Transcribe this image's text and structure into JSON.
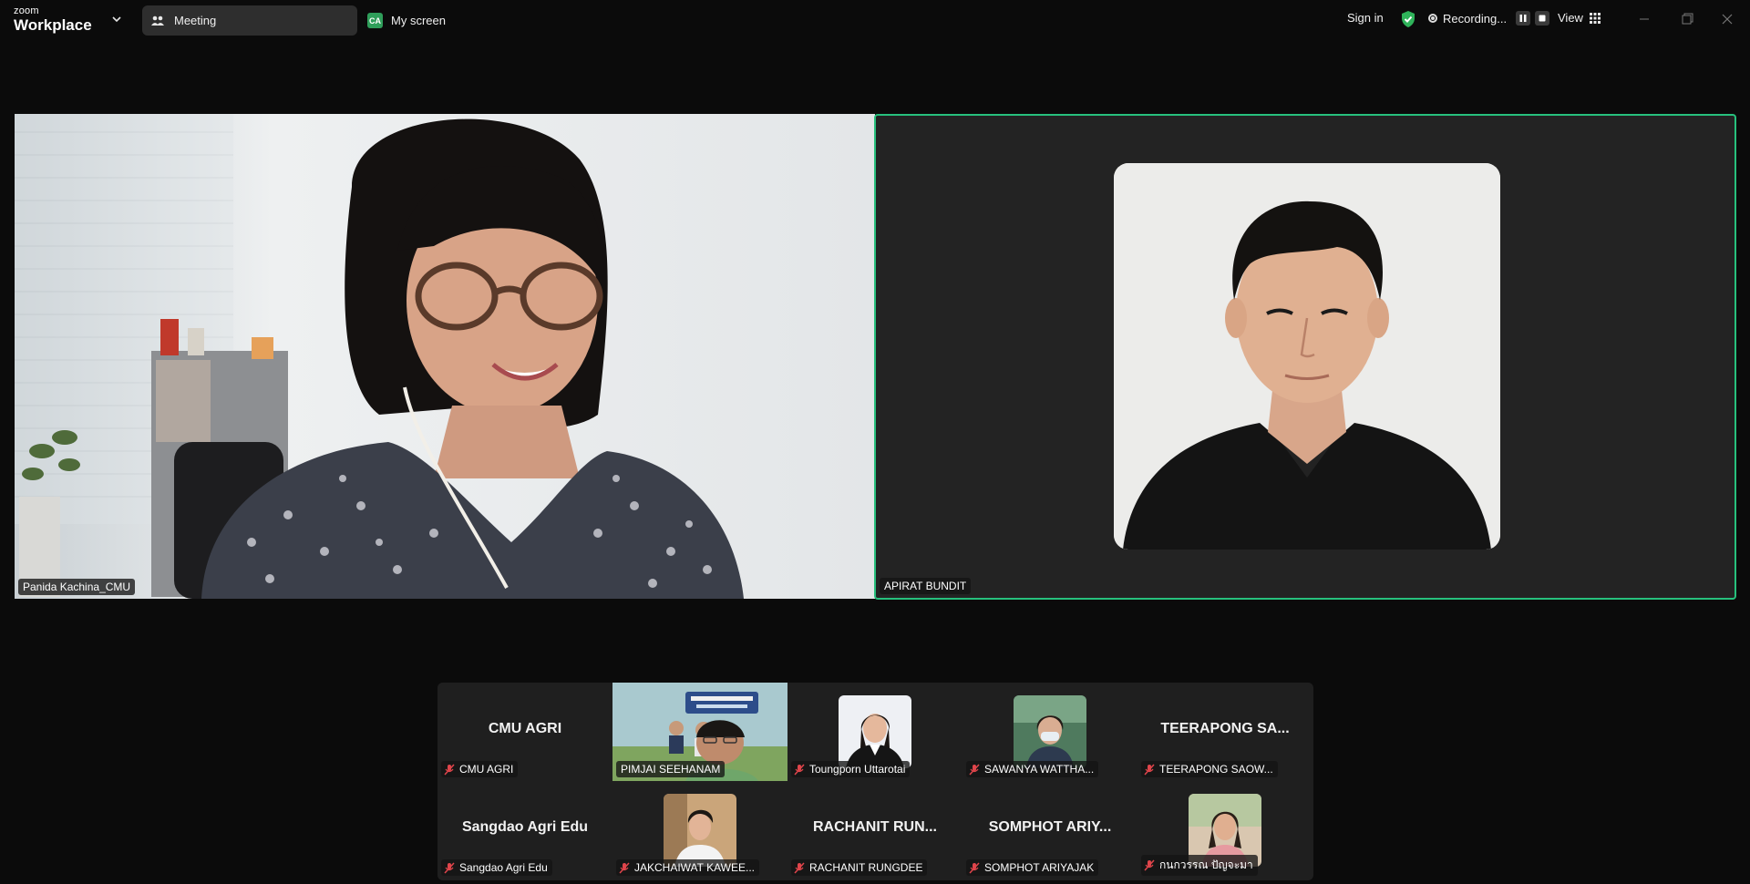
{
  "app": {
    "logo_small": "zoom",
    "logo_big": "Workplace"
  },
  "tabs": {
    "meeting": "Meeting",
    "my_screen": "My screen",
    "my_screen_badge": "CA"
  },
  "header": {
    "sign_in": "Sign in",
    "recording": "Recording...",
    "view": "View"
  },
  "main_videos": [
    {
      "name": "Panida Kachina_CMU",
      "active_speaker": false
    },
    {
      "name": "APIRAT BUNDIT",
      "active_speaker": true
    }
  ],
  "gallery": [
    {
      "display": "CMU AGRI",
      "name": "CMU AGRI",
      "muted": true,
      "kind": "text"
    },
    {
      "display": "",
      "name": "PIMJAI SEEHANAM",
      "muted": false,
      "kind": "video"
    },
    {
      "display": "",
      "name": "Toungporn Uttarotai",
      "muted": true,
      "kind": "photo"
    },
    {
      "display": "",
      "name": "SAWANYA WATTHA...",
      "muted": true,
      "kind": "photo"
    },
    {
      "display": "TEERAPONG SA...",
      "name": "TEERAPONG SAOW...",
      "muted": true,
      "kind": "text"
    },
    {
      "display": "Sangdao Agri Edu",
      "name": "Sangdao Agri Edu",
      "muted": true,
      "kind": "text"
    },
    {
      "display": "",
      "name": "JAKCHAIWAT KAWEE...",
      "muted": true,
      "kind": "photo"
    },
    {
      "display": "RACHANIT RUN...",
      "name": "RACHANIT RUNGDEE",
      "muted": true,
      "kind": "text"
    },
    {
      "display": "SOMPHOT ARIY...",
      "name": "SOMPHOT ARIYAJAK",
      "muted": true,
      "kind": "text"
    },
    {
      "display": "",
      "name": "กนกวรรณ ปัญจะมา",
      "muted": true,
      "kind": "photo"
    }
  ],
  "colors": {
    "active_border": "#27c07d",
    "muted_icon": "#e0454b",
    "shield": "#2fb35a"
  },
  "icons": [
    "chevron-down-icon",
    "meeting-icon",
    "shield-check-icon",
    "record-icon",
    "pause-icon",
    "stop-icon",
    "grid-view-icon",
    "minimize-icon",
    "maximize-icon",
    "close-icon",
    "mic-muted-icon"
  ]
}
